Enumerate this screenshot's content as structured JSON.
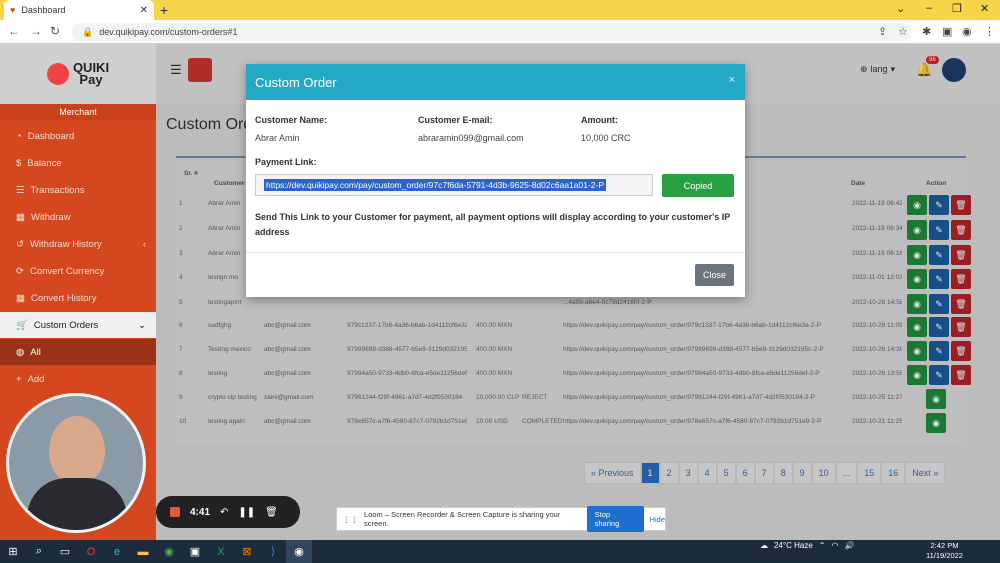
{
  "browser": {
    "tab_title": "Dashboard",
    "url": "dev.quikipay.com/custom-orders#1"
  },
  "app": {
    "logo_line1": "QUIKI",
    "logo_line2": "Pay",
    "sidebar_heading": "Merchant",
    "sidebar": [
      {
        "label": "Dashboard",
        "icon": "dashboard-icon"
      },
      {
        "label": "Balance",
        "icon": "dollar-icon"
      },
      {
        "label": "Transactions",
        "icon": "list-icon"
      },
      {
        "label": "Withdraw",
        "icon": "table-icon"
      },
      {
        "label": "Withdraw History",
        "icon": "history-icon"
      },
      {
        "label": "Convert Currency",
        "icon": "convert-icon"
      },
      {
        "label": "Convert History",
        "icon": "table-icon"
      },
      {
        "label": "Custom Orders",
        "icon": "cart-icon"
      },
      {
        "label": "All",
        "icon": "globe-icon"
      },
      {
        "label": "Add",
        "icon": "plus-icon"
      }
    ],
    "page_title": "Custom Orders",
    "lang": "lang",
    "notif_count": "96",
    "table": {
      "headers": [
        "Sr. #",
        "Customer Name",
        "Date",
        "Action"
      ],
      "rows": [
        {
          "sr": "1",
          "name": "Abrar Amin",
          "date": "2022-11-19 06:42:47",
          "link": "...4d3b-9625-8d02c6aa1a01-2-P"
        },
        {
          "sr": "2",
          "name": "Abrar Amin",
          "date": "2022-11-19 06:34:54",
          "link": "...40ba-b0c9-0f59b3d386ab-2-P"
        },
        {
          "sr": "3",
          "name": "Abrar Amin",
          "date": "2022-11-19 06:18:22",
          "link": "...43cc-9c0e-40b80f481519-2-P"
        },
        {
          "sr": "4",
          "name": "testign mo",
          "date": "2022-11-01 12:03:52",
          "link": "...4691-81a9-a4d6ce7a57d4-2-P"
        },
        {
          "sr": "5",
          "name": "testingapint",
          "date": "2022-10-28 14:58:21",
          "link": "...4a09-a6e4-0c79d24180f-2-P"
        },
        {
          "sr": "6",
          "name": "sadfghg",
          "email": "abc@gmail.com",
          "id": "979c1337-17b6-4a36-b6ab-1d4112cf6e3a",
          "amount": "400.00 MXN",
          "link": "https://dev.quikipay.com/pay/custom_order/979c1337-17b6-4a36-b6ab-1d4112cf6e3a-2-P",
          "date": "2022-10-28 11:09:30"
        },
        {
          "sr": "7",
          "name": "Testing mexico",
          "email": "abc@gmail.com",
          "id": "97989699-d388-4577-b5e9-3129d032195c",
          "amount": "400.00 MXN",
          "link": "https://dev.quikipay.com/pay/custom_order/97989699-d388-4577-b5e9-3129d032195c-2-P",
          "date": "2022-10-26 14:30:37"
        },
        {
          "sr": "8",
          "name": "testing",
          "email": "abc@gmail.com",
          "id": "97984a50-9733-4db0-8fca-e5de11256def",
          "amount": "400.00 MXN",
          "link": "https://dev.quikipay.com/pay/custom_order/97984a50-9733-4db0-8fca-e5de11256def-2-P",
          "date": "2022-10-26 13:59:26"
        },
        {
          "sr": "9",
          "name": "crypto clp testing",
          "email": "zaini@gmail.com",
          "id": "97961244-f29f-4961-a7d7-4d2f0530184",
          "amount": "10,000.00 CLP",
          "status": "REJECT",
          "link": "https://dev.quikipay.com/pay/custom_order/97961244-f29f-4961-a7d7-4d2f0530184-2-P",
          "date": "2022-10-25 11:27:52"
        },
        {
          "sr": "10",
          "name": "testing again",
          "email": "abc@gmail.com",
          "id": "978e657c-a7f6-4580-87c7-0792b1d751e9",
          "amount": "10.00 USD",
          "status": "COMPLETED",
          "link": "https://dev.quikipay.com/pay/custom_order/978e657c-a7f6-4580-87c7-0792b1d751e9-2-P",
          "date": "2022-10-21 11:25:32"
        }
      ]
    },
    "pagination": [
      "« Previous",
      "1",
      "2",
      "3",
      "4",
      "5",
      "6",
      "7",
      "8",
      "9",
      "10",
      "...",
      "15",
      "16",
      "Next »"
    ],
    "pagination_current": "1"
  },
  "modal": {
    "title": "Custom Order",
    "close_x": "×",
    "customer_name_label": "Customer Name:",
    "customer_name": "Abrar Amin",
    "customer_email_label": "Customer E-mail:",
    "customer_email": "abraramin099@gmail.com",
    "amount_label": "Amount:",
    "amount": "10,000 CRC",
    "payment_link_label": "Payment Link:",
    "payment_link": "https://dev.quikipay.com/pay/custom_order/97c7f6da-5791-4d3b-9625-8d02c6aa1a01-2-P",
    "copied_button": "Copied",
    "message": "Send This Link to your Customer for payment, all payment options will display according to your customer's IP address",
    "close_button": "Close"
  },
  "recorder": {
    "time": "4:41"
  },
  "loom": {
    "text": "Loom – Screen Recorder & Screen Capture is sharing your screen.",
    "stop_label": "Stop sharing",
    "hide_label": "Hide"
  },
  "taskbar": {
    "weather": "24°C  Haze",
    "time": "2:42 PM",
    "date": "11/19/2022"
  },
  "colors": {
    "sidebar": "#d5471f",
    "modal_header": "#23a9c6",
    "copied": "#27a043",
    "pager_active": "#2d6cc0"
  }
}
